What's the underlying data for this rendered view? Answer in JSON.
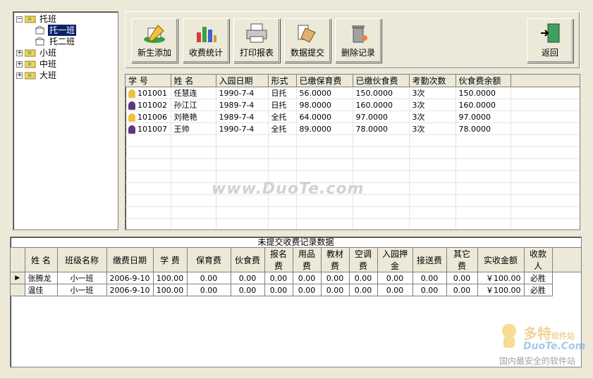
{
  "tree": {
    "root": "托班",
    "children": [
      "托一班",
      "托二班"
    ],
    "others": [
      "小班",
      "中班",
      "大班"
    ]
  },
  "toolbar": {
    "new_student": "新生添加",
    "fee_stats": "收费统计",
    "print_report": "打印报表",
    "submit_data": "数据提交",
    "delete_record": "删除记录",
    "back": "返回"
  },
  "students": {
    "headers": [
      "学 号",
      "姓 名",
      "入园日期",
      "形式",
      "已缴保育费",
      "已缴伙食费",
      "考勤次数",
      "伙食费余额"
    ],
    "rows": [
      [
        "101001",
        "任慧连",
        "1990-7-4",
        "日托",
        "56.0000",
        "150.0000",
        "3次",
        "150.0000"
      ],
      [
        "101002",
        "孙江江",
        "1989-7-4",
        "日托",
        "98.0000",
        "160.0000",
        "3次",
        "160.0000"
      ],
      [
        "101006",
        "刘艳艳",
        "1989-7-4",
        "全托",
        "64.0000",
        "97.0000",
        "3次",
        "97.0000"
      ],
      [
        "101007",
        "王帅",
        "1990-7-4",
        "全托",
        "89.0000",
        "78.0000",
        "3次",
        "78.0000"
      ]
    ]
  },
  "fees": {
    "title": "未提交收费记录数据",
    "headers": [
      "姓 名",
      "班级名称",
      "缴费日期",
      "学 费",
      "保育费",
      "伙食费",
      "报名费",
      "用品费",
      "教材费",
      "空调费",
      "入园押金",
      "接送费",
      "其它费",
      "实收金额",
      "收款人"
    ],
    "rows": [
      [
        "张腾龙",
        "小一班",
        "2006-9-10",
        "100.00",
        "0.00",
        "0.00",
        "0.00",
        "0.00",
        "0.00",
        "0.00",
        "0.00",
        "0.00",
        "0.00",
        "￥100.00",
        "必胜"
      ],
      [
        "温佳",
        "小一班",
        "2006-9-10",
        "100.00",
        "0.00",
        "0.00",
        "0.00",
        "0.00",
        "0.00",
        "0.00",
        "0.00",
        "0.00",
        "0.00",
        "￥100.00",
        "必胜"
      ]
    ],
    "current_row_marker": "▶"
  },
  "watermark": {
    "center": "www.DuoTe.com",
    "logo_cn": "多特",
    "logo_small": "软件站",
    "logo_en": "DuoTe.Com",
    "logo_tag": "国内最安全的软件站"
  }
}
